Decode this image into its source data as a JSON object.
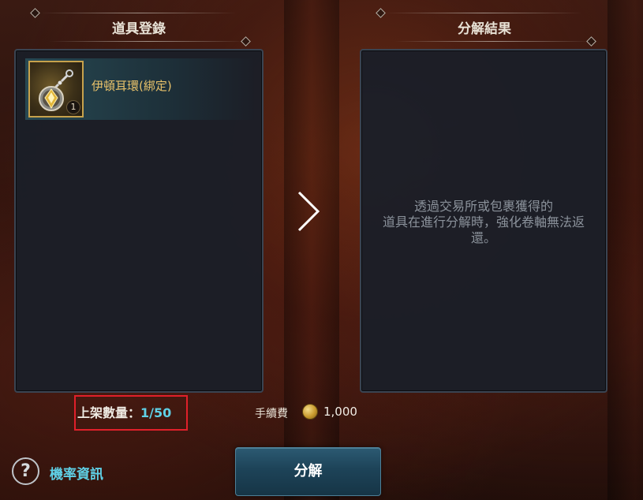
{
  "left_panel": {
    "title": "道具登錄",
    "items": [
      {
        "name": "伊頓耳環(綁定)",
        "count": "1",
        "icon": "earring-icon"
      }
    ]
  },
  "right_panel": {
    "title": "分解結果",
    "notice_lines": [
      "透過交易所或包裹獲得的",
      "道具在進行分解時，強化卷軸無法返",
      "還。"
    ]
  },
  "listing": {
    "label": "上架數量：",
    "count": "1/50"
  },
  "fee": {
    "label": "手續費",
    "icon": "gold-coin-icon",
    "value": "1,000"
  },
  "help": {
    "icon_glyph": "?",
    "link_label": "機率資訊"
  },
  "actions": {
    "decompose_label": "分解"
  },
  "colors": {
    "accent_cyan": "#5fd0e6",
    "item_name_gold": "#e7c16a",
    "highlight_red": "#e0202a",
    "button_blue": "#1d4358"
  }
}
